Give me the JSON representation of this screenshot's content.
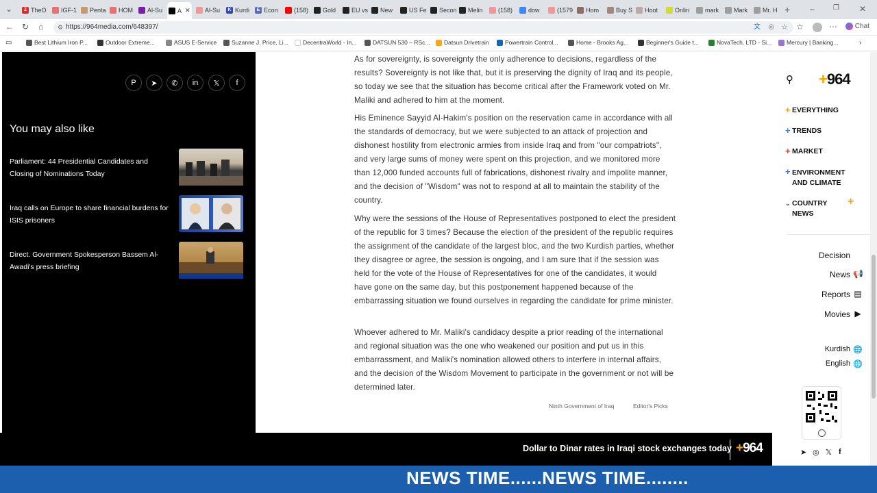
{
  "browser": {
    "tabs": [
      {
        "label": "TheO",
        "color": "#d32f2f",
        "glyph": "Z"
      },
      {
        "label": "IGF-1",
        "color": "#e57373",
        "glyph": ""
      },
      {
        "label": "Penta",
        "color": "#c59a6e",
        "glyph": ""
      },
      {
        "label": "HOM",
        "color": "#e57373",
        "glyph": ""
      },
      {
        "label": "Al-Su",
        "color": "#7b1fa2",
        "glyph": ""
      },
      {
        "label": "A",
        "color": "#000000",
        "glyph": ""
      },
      {
        "label": "Al-Su",
        "color": "#ef9a9a",
        "glyph": ""
      },
      {
        "label": "Kurdi",
        "color": "#3949ab",
        "glyph": "K"
      },
      {
        "label": "Econ",
        "color": "#5c6bc0",
        "glyph": "E"
      },
      {
        "label": "(158)",
        "color": "#ff0000",
        "glyph": ""
      },
      {
        "label": "Gold",
        "color": "#222222",
        "glyph": ""
      },
      {
        "label": "EU vs",
        "color": "#222222",
        "glyph": ""
      },
      {
        "label": "New",
        "color": "#222222",
        "glyph": ""
      },
      {
        "label": "US Fe",
        "color": "#222222",
        "glyph": ""
      },
      {
        "label": "Secon",
        "color": "#222222",
        "glyph": ""
      },
      {
        "label": "Melin",
        "color": "#222222",
        "glyph": ""
      },
      {
        "label": "(158)",
        "color": "#ef9a9a",
        "glyph": ""
      },
      {
        "label": "dow",
        "color": "#4285f4",
        "glyph": ""
      },
      {
        "label": "(1579",
        "color": "#ef9a9a",
        "glyph": ""
      },
      {
        "label": "Hom",
        "color": "#8d6e63",
        "glyph": ""
      },
      {
        "label": "Buy S",
        "color": "#a1887f",
        "glyph": ""
      },
      {
        "label": "Hoot",
        "color": "#bcaaa4",
        "glyph": ""
      },
      {
        "label": "Onlin",
        "color": "#cddc39",
        "glyph": ""
      },
      {
        "label": "mark",
        "color": "#9e9e9e",
        "glyph": ""
      },
      {
        "label": "Mark",
        "color": "#9e9e9e",
        "glyph": ""
      },
      {
        "label": "Mr. H",
        "color": "#9e9e9e",
        "glyph": ""
      }
    ],
    "url": "https://964media.com/648397/",
    "chat_label": "Chat",
    "bookmarks": [
      {
        "label": "Best Lithium Iron P...",
        "color": "#555555"
      },
      {
        "label": "Outdoor Extreme...",
        "color": "#333333"
      },
      {
        "label": "ASUS E-Service",
        "color": "#888888"
      },
      {
        "label": "Suzanne J. Price, Li...",
        "color": "#555555"
      },
      {
        "label": "DecentraWorld - In...",
        "color": "#ffffff"
      },
      {
        "label": "DATSUN 530 – RSc...",
        "color": "#555555"
      },
      {
        "label": "Datsun Drivetrain",
        "color": "#f9a825"
      },
      {
        "label": "Powertrain Control...",
        "color": "#1565c0"
      },
      {
        "label": "Home - Brooks Ag...",
        "color": "#555555"
      },
      {
        "label": "Beginner's Guide t...",
        "color": "#333333"
      },
      {
        "label": "NovaTech, LTD - Si...",
        "color": "#2e7d32"
      },
      {
        "label": "Mercury | Banking...",
        "color": "#9575cd"
      }
    ]
  },
  "related": {
    "heading": "You may also like",
    "items": [
      {
        "title": "Parliament: 44 Presidential Candidates and Closing of Nominations Today"
      },
      {
        "title": "Iraq calls on Europe to share financial burdens for ISIS prisoners"
      },
      {
        "title": "Direct. Government Spokesperson Bassem Al-Awadi's press briefing"
      }
    ]
  },
  "share_icons": [
    "pinterest-icon",
    "telegram-icon",
    "whatsapp-icon",
    "linkedin-icon",
    "x-icon",
    "facebook-icon"
  ],
  "article": {
    "paragraphs": [
      "As for sovereignty, is sovereignty the only adherence to decisions, regardless of the results? Sovereignty is not like that, but it is preserving the dignity of Iraq and its people, so today we see that the situation has become critical after the Framework voted on Mr. Maliki and adhered to him at the moment.",
      "His Eminence Sayyid Al-Hakim's position on the reservation came in accordance with all the standards of democracy, but we were subjected to an attack of projection and dishonest hostility from electronic armies from inside Iraq and from \"our compatriots\", and very large sums of money were spent on this projection, and we monitored more than 12,000 funded accounts full of fabrications, dishonest rivalry and impolite manner, and the decision of \"Wisdom\" was not to respond at all to maintain the stability of the country.",
      "Why were the sessions of the House of Representatives postponed to elect the president of the republic for 3 times? Because the election of the president of the republic requires the assignment of the candidate of the largest bloc, and the two Kurdish parties, whether they disagree or agree, the session is ongoing, and I am sure that if the session was held for the vote of the House of Representatives for one of the candidates, it would have gone on the same day, but this postponement happened because of the embarrassing situation we found ourselves in regarding the candidate for prime minister.",
      "Whoever adhered to Mr. Maliki's candidacy despite a prior reading of the international and regional situation was the one who weakened our position and put us in this embarrassment, and Maliki's nomination allowed others to interfere in internal affairs, and the decision of the Wisdom Movement to participate in the government or not will be determined later."
    ],
    "tags": [
      "Ninth Government of Iraq",
      "Editor's Picks"
    ]
  },
  "sidebar": {
    "logo": "+964",
    "menu": [
      {
        "label": "EVERYTHING",
        "color": "#f5a300"
      },
      {
        "label": "TRENDS",
        "color": "#3f7fd9"
      },
      {
        "label": "MARKET",
        "color": "#e53935"
      },
      {
        "label": "ENVIRONMENT AND CLIMATE",
        "color": "#3f7fd9"
      },
      {
        "label": "COUNTRY NEWS",
        "color": "#f5a300"
      }
    ],
    "sections": [
      "Decision",
      "News",
      "Reports",
      "Movies"
    ],
    "languages": [
      "Kurdish",
      "English"
    ]
  },
  "bottom_bar": {
    "headline": "Dollar to Dinar rates in Iraqi stock exchanges today",
    "logo": "+964"
  },
  "ticker": {
    "text": "NEWS TIME......NEWS TIME........"
  },
  "colors": {
    "accent_yellow": "#f5a300",
    "ticker_blue": "#1b5fae"
  }
}
